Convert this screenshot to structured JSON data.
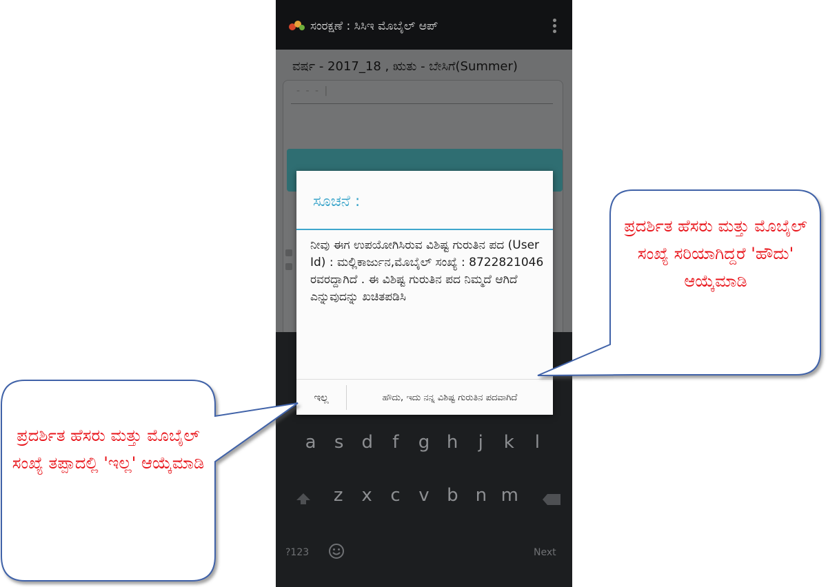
{
  "app": {
    "title": "ಸಂರಕ್ಷಣೆ : ಸಿಸಿಇ ಮೊಬೈಲ್ ಆಪ್",
    "season": "ವರ್ಷ - 2017_18 , ಋತು - ಬೇಸಿಗೆ(Summer)",
    "field_value": "- - - |"
  },
  "dialog": {
    "title": "ಸೂಚನೆ :",
    "message": "ನೀವು ಈಗ ಉಪಯೋಗಿಸಿರುವ ವಿಶಿಷ್ಟ ಗುರುತಿನ ಪದ (User Id) : ಮಲ್ಲಿಕಾರ್ಜುನ,ಮೊಬೈಲ್ ಸಂಖ್ಯೆ : 8722821046 ರವರದ್ದಾಗಿದೆ . ಈ ವಿಶಿಷ್ಟ ಗುರುತಿನ ಪದ ನಿಮ್ಮದೆ ಆಗಿದೆ ಎನ್ನುವುದನ್ನು ಖಚಿತಪಡಿಸಿ",
    "no_label": "ಇಲ್ಲ",
    "yes_label": "ಹೌದು, ಇದು ನನ್ನ ವಿಶಿಷ್ಟ ಗುರುತಿನ ಪದವಾಗಿದೆ"
  },
  "keyboard": {
    "row2": [
      "a",
      "s",
      "d",
      "f",
      "g",
      "h",
      "j",
      "k",
      "l"
    ],
    "row3": [
      "z",
      "x",
      "c",
      "v",
      "b",
      "n",
      "m"
    ],
    "row4_left": "?123",
    "row4_right": "Next"
  },
  "callouts": {
    "right": "ಪ್ರದರ್ಶಿತ ಹೆಸರು ಮತ್ತು ಮೊಬೈಲ್ ಸಂಖ್ಯೆ ಸರಿಯಾಗಿದ್ದರೆ 'ಹೌದು' ಆಯ್ಕೆಮಾಡಿ",
    "left": "ಪ್ರದರ್ಶಿತ ಹೆಸರು ಮತ್ತು ಮೊಬೈಲ್ ಸಂಖ್ಯೆ ತಪ್ಪಾದಲ್ಲಿ 'ಇಲ್ಲ' ಆಯ್ಕೆಮಾಡಿ",
    "border_color": "#3f62a8",
    "text_color": "#e8141a"
  }
}
